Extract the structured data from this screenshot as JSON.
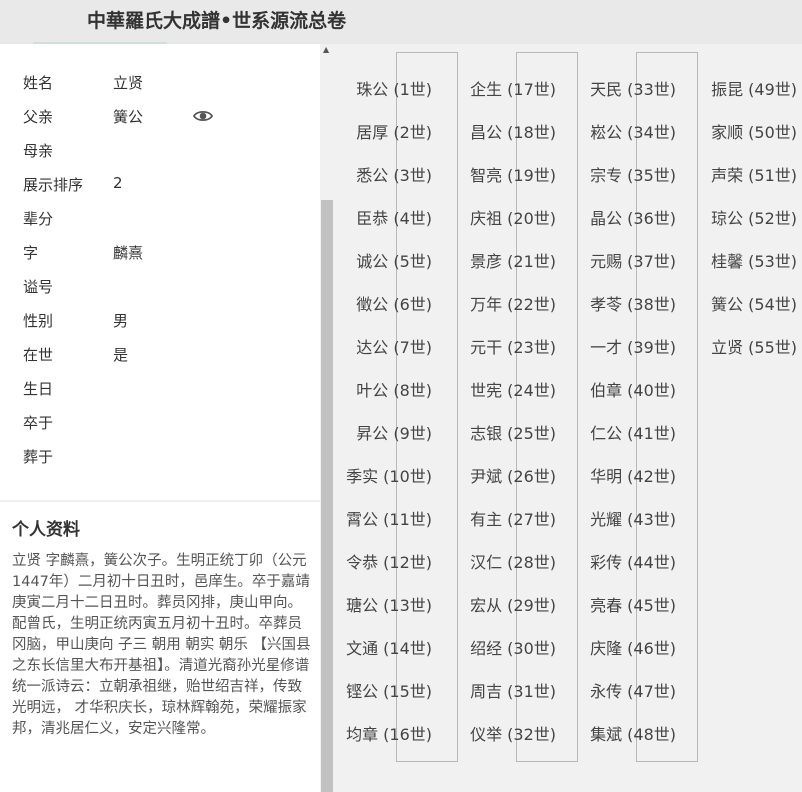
{
  "header": {
    "title": "中華羅氏大成譜•世系源流总卷"
  },
  "person": {
    "fields": [
      {
        "label": "姓名",
        "value": "立贤"
      },
      {
        "label": "父亲",
        "value": "簧公"
      },
      {
        "label": "母亲",
        "value": ""
      },
      {
        "label": "展示排序",
        "value": "2"
      },
      {
        "label": "辈分",
        "value": ""
      },
      {
        "label": "字",
        "value": "麟熹"
      },
      {
        "label": "谥号",
        "value": ""
      },
      {
        "label": "性别",
        "value": "男"
      },
      {
        "label": "在世",
        "value": "是"
      },
      {
        "label": "生日",
        "value": ""
      },
      {
        "label": "卒于",
        "value": ""
      },
      {
        "label": "葬于",
        "value": ""
      }
    ],
    "eye_icon": "eye-icon"
  },
  "profile": {
    "title": "个人资料",
    "text": "立贤  字麟熹，簧公次子。生明正统丁卯（公元1447年）二月初十日丑时，邑庠生。卒于嘉靖庚寅二月十二日丑时。葬员冈排，庚山甲向。配曾氏，生明正统丙寅五月初十丑时。卒葬员冈脑，甲山庚向  子三  朝用  朝实  朝乐 【兴国县之东长信里大布开基祖】。清道光裔孙光星修谱统一派诗云：立朝承祖继，贻世绍吉祥，传致光明远，  才华积庆长，琼林辉翰苑，荣耀振家邦，清兆居仁义，安定兴隆常。"
  },
  "generations": [
    "珠公 (1世)",
    "居厚 (2世)",
    "悉公 (3世)",
    "臣恭 (4世)",
    "诚公 (5世)",
    "徵公 (6世)",
    "达公 (7世)",
    "叶公 (8世)",
    "昇公 (9世)",
    "季实 (10世)",
    "霄公 (11世)",
    "令恭 (12世)",
    "瑭公 (13世)",
    "文通 (14世)",
    "铿公 (15世)",
    "均章 (16世)",
    "企生 (17世)",
    "昌公 (18世)",
    "智亮 (19世)",
    "庆祖 (20世)",
    "景彦 (21世)",
    "万年 (22世)",
    "元干 (23世)",
    "世宪 (24世)",
    "志银 (25世)",
    "尹斌 (26世)",
    "有主 (27世)",
    "汉仁 (28世)",
    "宏从 (29世)",
    "绍经 (30世)",
    "周吉 (31世)",
    "仪举 (32世)",
    "天民 (33世)",
    "崧公 (34世)",
    "宗专 (35世)",
    "晶公 (36世)",
    "元赐 (37世)",
    "孝苓 (38世)",
    "一才 (39世)",
    "伯章 (40世)",
    "仁公 (41世)",
    "华明 (42世)",
    "光耀 (43世)",
    "彩传 (44世)",
    "亮春 (45世)",
    "庆隆 (46世)",
    "永传 (47世)",
    "集斌 (48世)",
    "振昆 (49世)",
    "家顺 (50世)",
    "声荣 (51世)",
    "琼公 (52世)",
    "桂馨 (53世)",
    "簧公 (54世)",
    "立贤 (55世)"
  ]
}
